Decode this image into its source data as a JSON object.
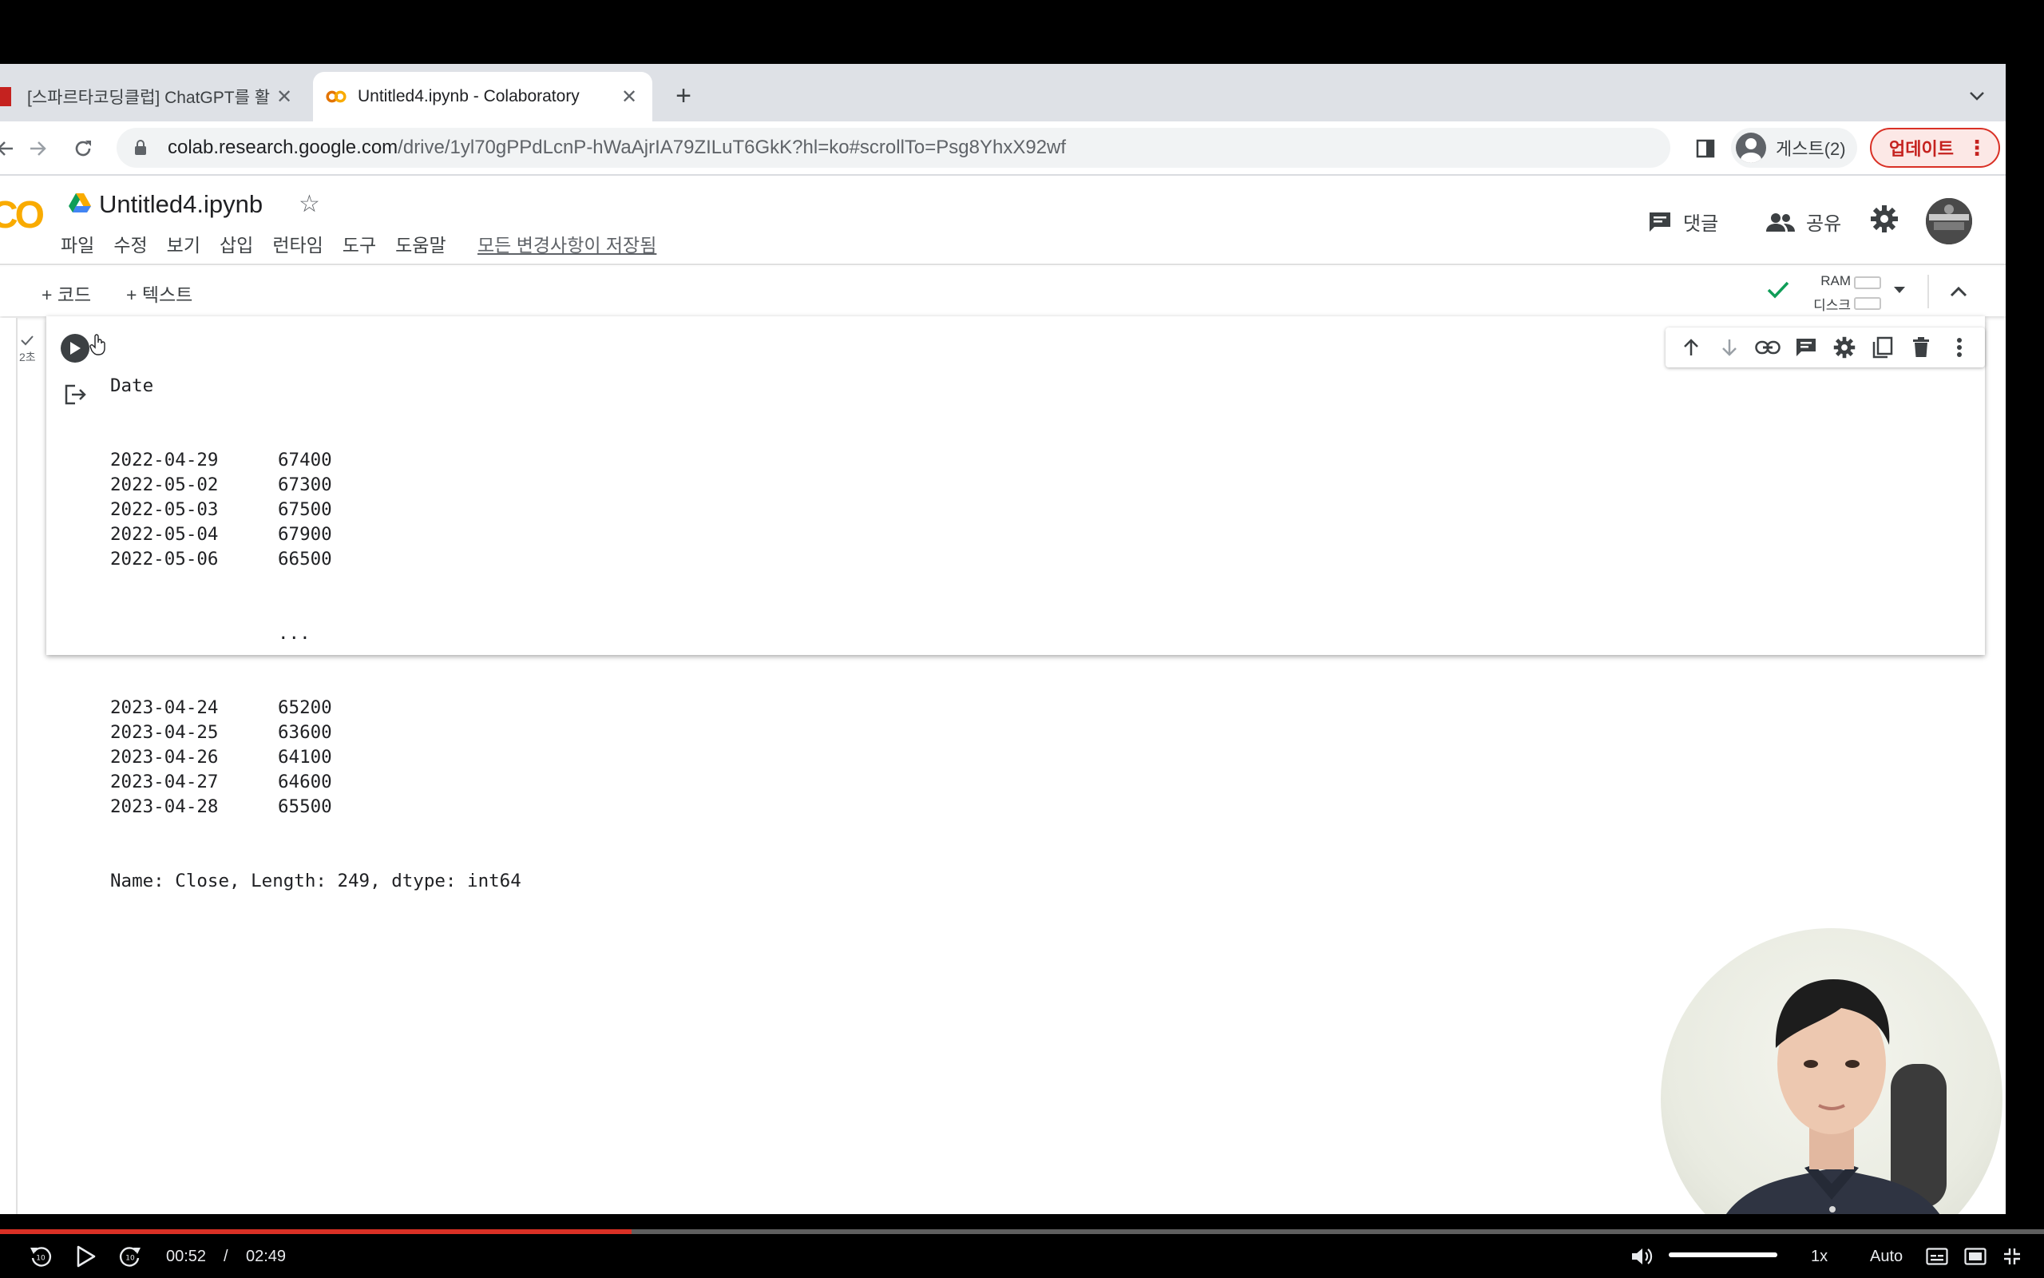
{
  "browser": {
    "tabs": [
      {
        "title": "[스파르타코딩클럽] ChatGPT를 활",
        "active": false
      },
      {
        "title": "Untitled4.ipynb - Colaboratory",
        "active": true
      }
    ],
    "url_host": "colab.research.google.com",
    "url_path": "/drive/1yl70gPPdLcnP-hWaAjrIA79ZILuT6GkK?hl=ko#scrollTo=Psg8YhxX92wf",
    "profile_label": "게스트(2)",
    "update_label": "업데이트"
  },
  "colab": {
    "logo": "CO",
    "notebook_title": "Untitled4.ipynb",
    "menu": [
      "파일",
      "수정",
      "보기",
      "삽입",
      "런타임",
      "도구",
      "도움말"
    ],
    "save_status": "모든 변경사항이 저장됨",
    "comment_label": "댓글",
    "share_label": "공유",
    "add_code_label": "+ 코드",
    "add_text_label": "+ 텍스트",
    "ram_label": "RAM",
    "disk_label": "디스크"
  },
  "cell": {
    "exec_time": "2초",
    "output_header": "Date",
    "rows_top": [
      {
        "date": "2022-04-29",
        "value": "67400"
      },
      {
        "date": "2022-05-02",
        "value": "67300"
      },
      {
        "date": "2022-05-03",
        "value": "67500"
      },
      {
        "date": "2022-05-04",
        "value": "67900"
      },
      {
        "date": "2022-05-06",
        "value": "66500"
      }
    ],
    "ellipsis": "...",
    "rows_bottom": [
      {
        "date": "2023-04-24",
        "value": "65200"
      },
      {
        "date": "2023-04-25",
        "value": "63600"
      },
      {
        "date": "2023-04-26",
        "value": "64100"
      },
      {
        "date": "2023-04-27",
        "value": "64600"
      },
      {
        "date": "2023-04-28",
        "value": "65500"
      }
    ],
    "footer": "Name: Close, Length: 249, dtype: int64"
  },
  "player": {
    "current_time": "00:52",
    "separator": "/",
    "duration": "02:49",
    "progress_fraction": 0.309,
    "volume_fraction": 1.0,
    "speed": "1x",
    "quality": "Auto",
    "rewind_seconds": "10",
    "forward_seconds": "10"
  },
  "colors": {
    "accent_red": "#d93025",
    "colab_orange": "#f9ab00"
  }
}
